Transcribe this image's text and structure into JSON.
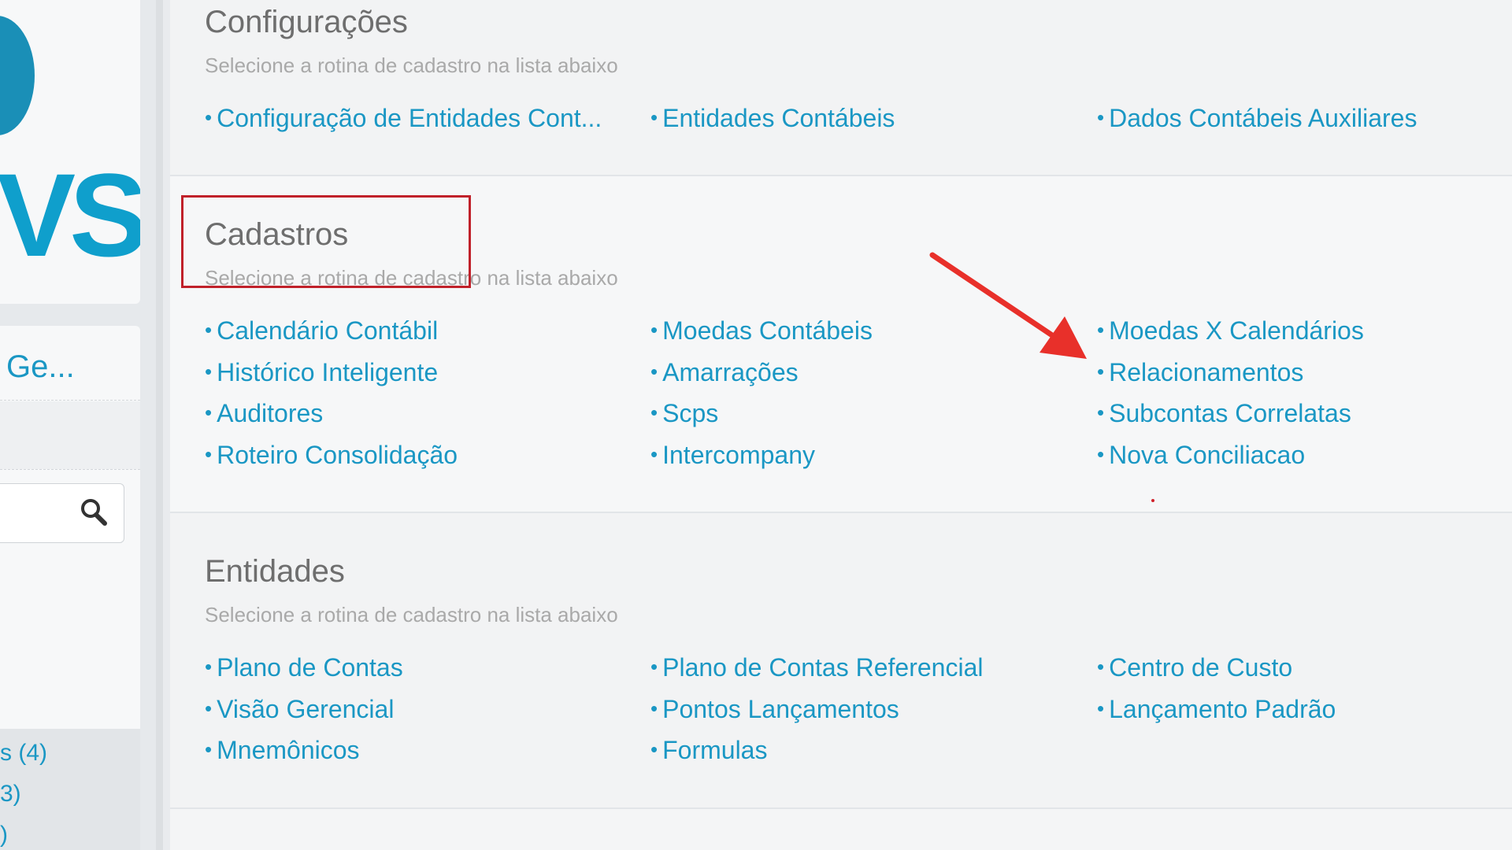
{
  "sidebar": {
    "logo_text": "VS",
    "menu_title": "Ge...",
    "counts": [
      "s (4)",
      "3)",
      ")"
    ]
  },
  "sections": {
    "configuracoes": {
      "title": "Configurações",
      "subtitle": "Selecione a rotina de cadastro na lista abaixo",
      "links": [
        "Configuração de Entidades Cont...",
        "Entidades Contábeis",
        "Dados Contábeis Auxiliares"
      ]
    },
    "cadastros": {
      "title": "Cadastros",
      "subtitle": "Selecione a rotina de cadastro na lista abaixo",
      "links": [
        "Calendário Contábil",
        "Moedas Contábeis",
        "Moedas X Calendários",
        "Histórico Inteligente",
        "Amarrações",
        "Relacionamentos",
        "Auditores",
        "Scps",
        "Subcontas Correlatas",
        "Roteiro Consolidação",
        "Intercompany",
        "Nova Conciliacao"
      ]
    },
    "entidades": {
      "title": "Entidades",
      "subtitle": "Selecione a rotina de cadastro na lista abaixo",
      "links": [
        "Plano de Contas",
        "Plano de Contas Referencial",
        "Centro de Custo",
        "Visão Gerencial",
        "Pontos Lançamentos",
        "Lançamento Padrão",
        "Mnemônicos",
        "Formulas"
      ]
    }
  },
  "bullet": "•",
  "colors": {
    "link": "#1a97c4",
    "title": "#6e6e6e",
    "subtitle": "#a9a9a9",
    "annotation": "#c0212a",
    "arrow": "#e8302a"
  },
  "icons": {
    "search": "search-icon",
    "annotation_arrow": "arrow-icon"
  }
}
